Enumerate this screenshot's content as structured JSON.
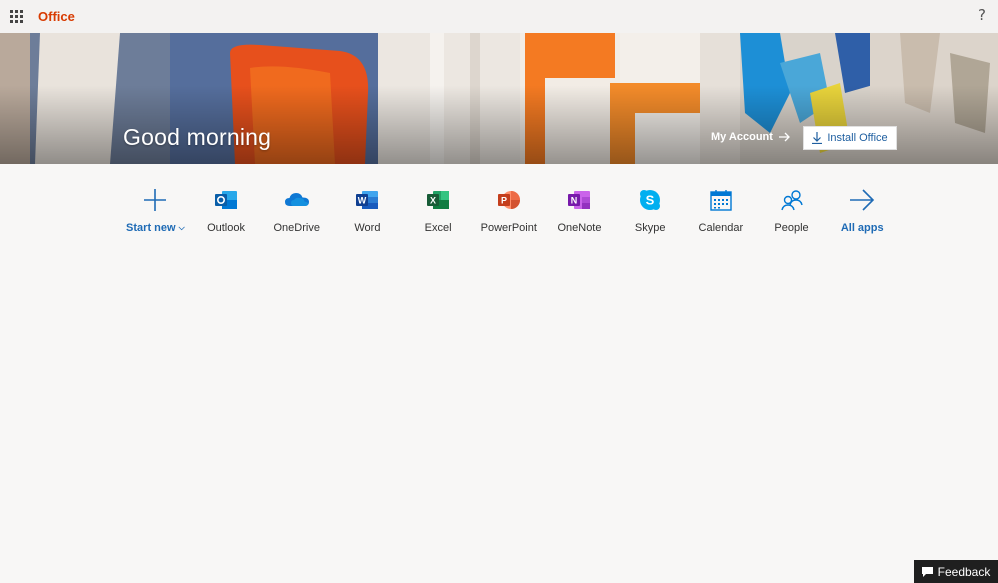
{
  "topbar": {
    "brand": "Office",
    "help_label": "?"
  },
  "hero": {
    "greeting": "Good morning",
    "my_account_label": "My Account",
    "install_label": "Install Office"
  },
  "apps": [
    {
      "label": "Start new",
      "icon": "plus-icon",
      "accent": "#1f6bb5"
    },
    {
      "label": "Outlook",
      "icon": "outlook-icon",
      "accent": "#0078d4"
    },
    {
      "label": "OneDrive",
      "icon": "onedrive-icon",
      "accent": "#0364b8"
    },
    {
      "label": "Word",
      "icon": "word-icon",
      "accent": "#2b579a"
    },
    {
      "label": "Excel",
      "icon": "excel-icon",
      "accent": "#217346"
    },
    {
      "label": "PowerPoint",
      "icon": "powerpoint-icon",
      "accent": "#d24726"
    },
    {
      "label": "OneNote",
      "icon": "onenote-icon",
      "accent": "#7719aa"
    },
    {
      "label": "Skype",
      "icon": "skype-icon",
      "accent": "#00aff0"
    },
    {
      "label": "Calendar",
      "icon": "calendar-icon",
      "accent": "#0078d4"
    },
    {
      "label": "People",
      "icon": "people-icon",
      "accent": "#0078d4"
    },
    {
      "label": "All apps",
      "icon": "arrow-right-icon",
      "accent": "#1f6bb5"
    }
  ],
  "feedback": {
    "label": "Feedback"
  },
  "colors": {
    "brand": "#d83b01",
    "accent_blue": "#1f6bb5",
    "page_bg": "#f8f7f6",
    "topbar_bg": "#f3f2f1"
  }
}
